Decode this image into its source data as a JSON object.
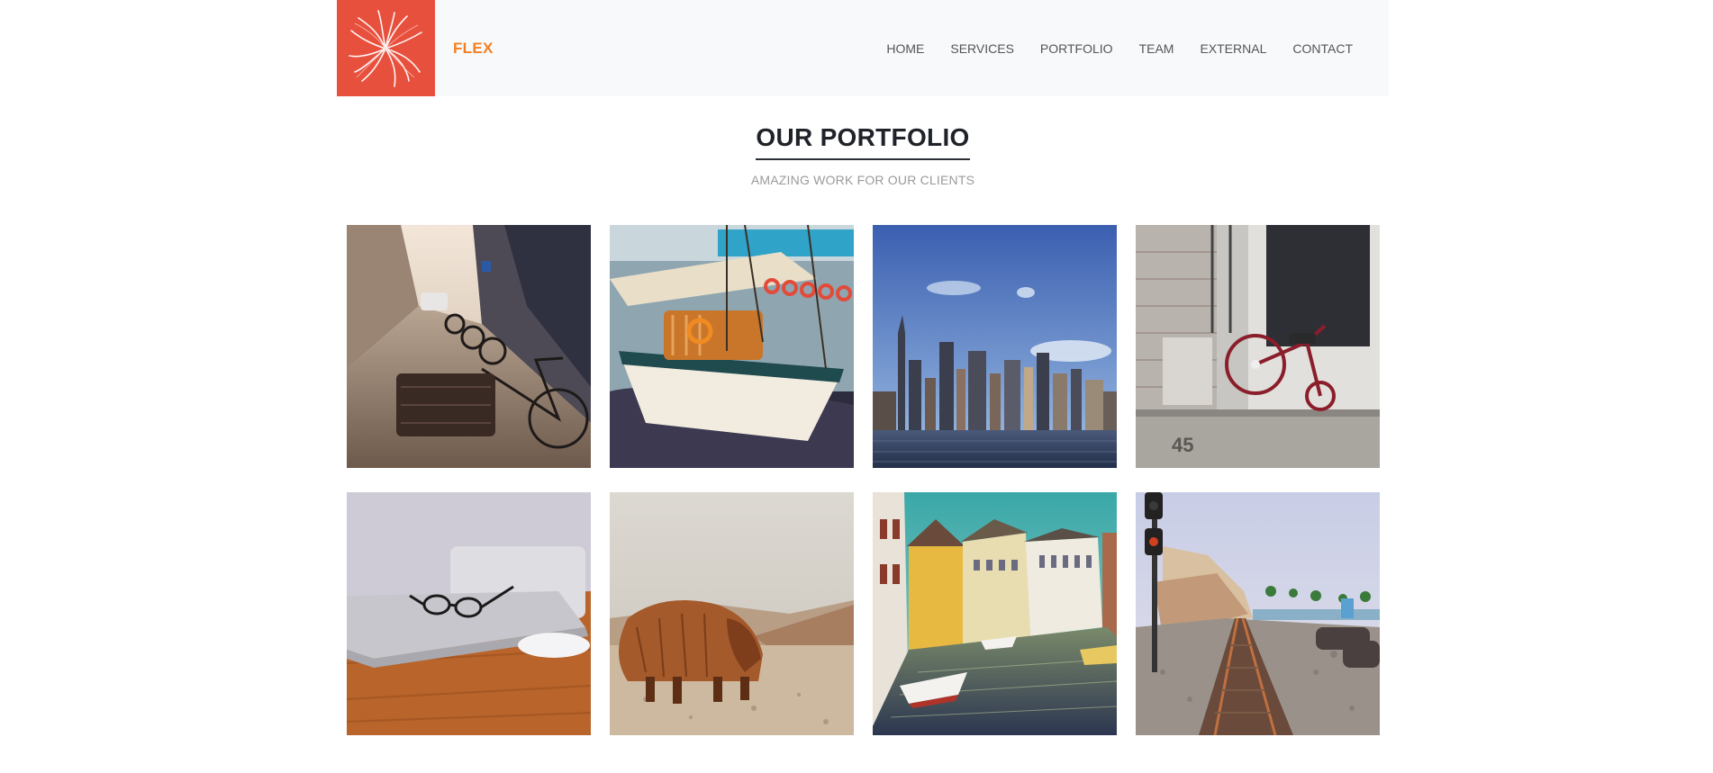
{
  "brand": {
    "name": "FLEX",
    "logo_icon": "feather-burst-icon",
    "logo_bg": "#e8503e",
    "brand_color": "#f57e20"
  },
  "nav": {
    "items": [
      {
        "label": "HOME"
      },
      {
        "label": "SERVICES"
      },
      {
        "label": "PORTFOLIO"
      },
      {
        "label": "TEAM"
      },
      {
        "label": "EXTERNAL"
      },
      {
        "label": "CONTACT"
      }
    ]
  },
  "portfolio": {
    "title": "OUR PORTFOLIO",
    "subtitle": "AMAZING WORK FOR OUR CLIENTS"
  }
}
